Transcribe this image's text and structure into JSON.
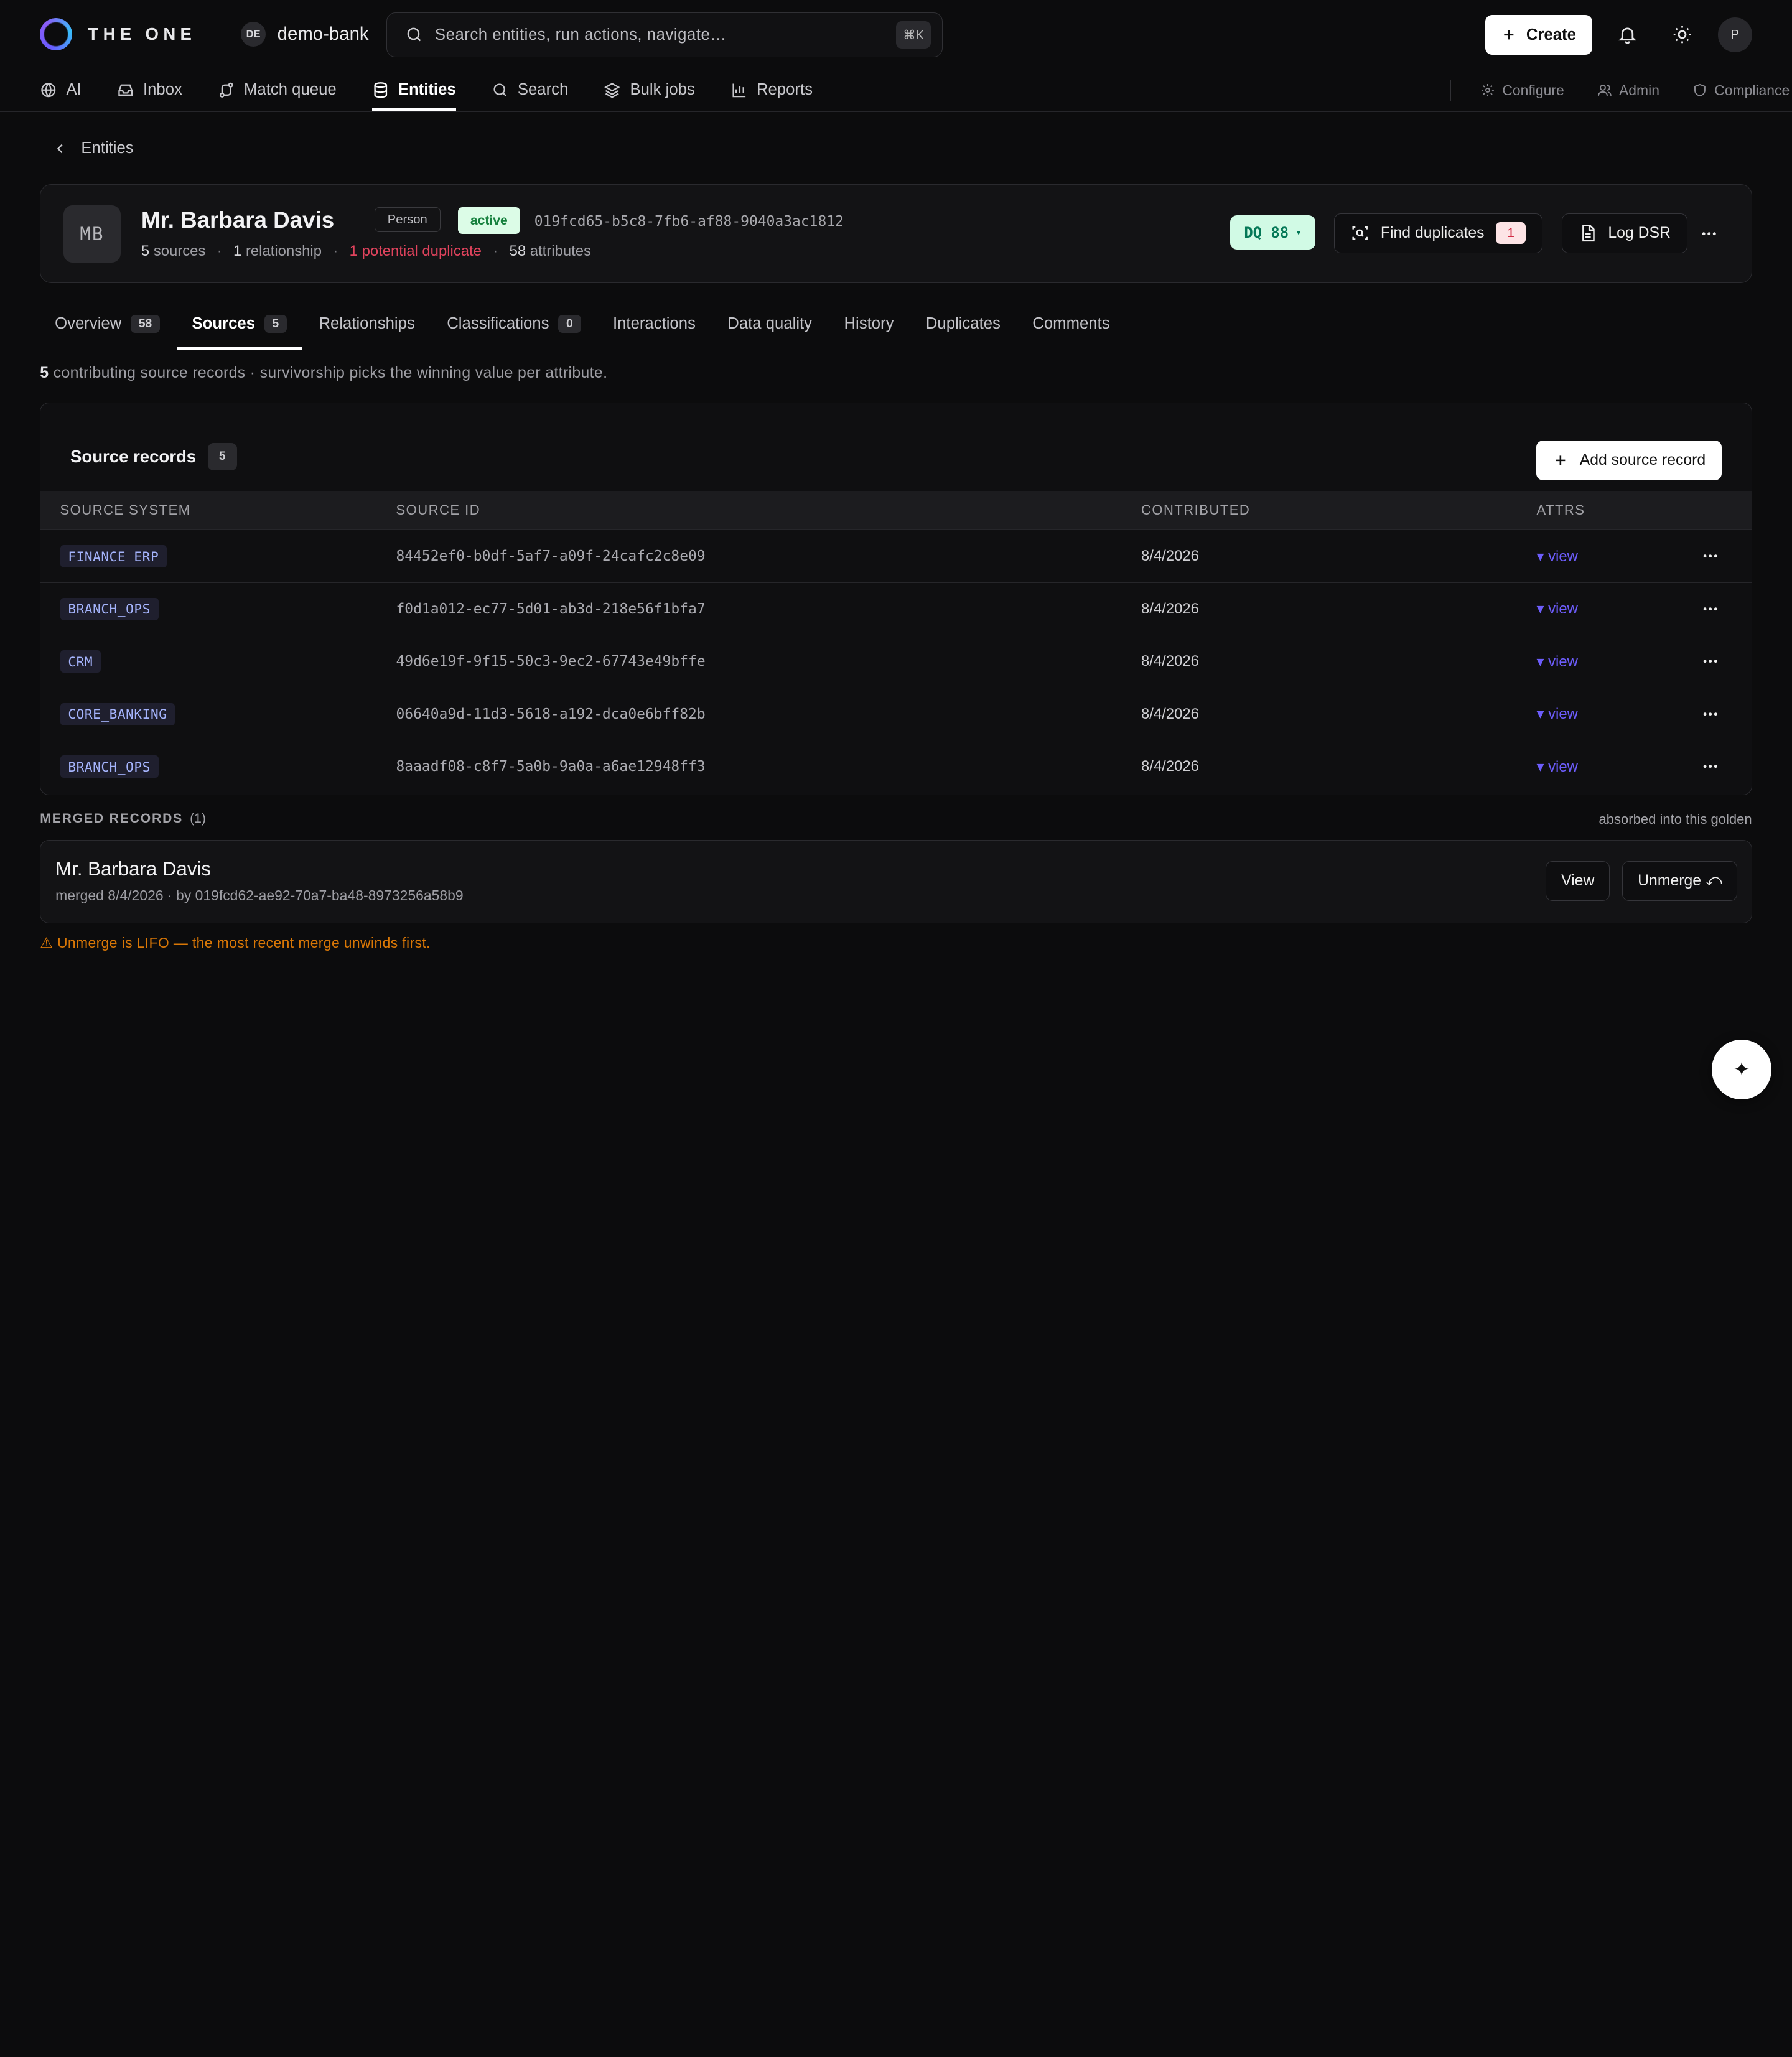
{
  "app": {
    "brand": "THE ONE",
    "workspace_initials": "DE",
    "workspace_name": "demo-bank"
  },
  "search": {
    "placeholder": "Search entities, run actions, navigate…",
    "shortcut": "⌘K"
  },
  "topbar": {
    "create_label": "Create",
    "avatar_initial": "P",
    "icons": [
      "plus-icon",
      "bell-icon",
      "sun-icon"
    ]
  },
  "nav": {
    "items": [
      {
        "label": "AI",
        "icon": "globe-icon"
      },
      {
        "label": "Inbox",
        "icon": "inbox-icon"
      },
      {
        "label": "Match queue",
        "icon": "route-icon"
      },
      {
        "label": "Entities",
        "icon": "database-icon",
        "active": true
      },
      {
        "label": "Search",
        "icon": "search-icon"
      },
      {
        "label": "Bulk jobs",
        "icon": "layers-icon"
      },
      {
        "label": "Reports",
        "icon": "bar-chart-icon"
      }
    ],
    "right": [
      {
        "label": "Configure",
        "icon": "gear-icon"
      },
      {
        "label": "Admin",
        "icon": "users-icon"
      },
      {
        "label": "Compliance",
        "icon": "shield-icon"
      }
    ]
  },
  "breadcrumb": {
    "back_label": "Entities"
  },
  "entity": {
    "initials": "MB",
    "name": "Mr. Barbara Davis",
    "type": "Person",
    "status": "active",
    "id": "019fcd65-b5c8-7fb6-af88-9040a3ac1812",
    "meta": {
      "sources_count": "5",
      "sources_label": "sources",
      "relationships_count": "1",
      "relationships_label": "relationship",
      "duplicate_text": "1 potential duplicate",
      "attributes_count": "58",
      "attributes_label": "attributes"
    },
    "dq_label": "DQ 88",
    "find_duplicates_label": "Find duplicates",
    "find_duplicates_count": "1",
    "log_dsr_label": "Log DSR"
  },
  "tabs": [
    {
      "label": "Overview",
      "count": "58"
    },
    {
      "label": "Sources",
      "count": "5",
      "active": true
    },
    {
      "label": "Relationships"
    },
    {
      "label": "Classifications",
      "count": "0"
    },
    {
      "label": "Interactions"
    },
    {
      "label": "Data quality"
    },
    {
      "label": "History"
    },
    {
      "label": "Duplicates"
    },
    {
      "label": "Comments"
    }
  ],
  "summary": {
    "count": "5",
    "text": "contributing source records · survivorship picks the winning value per attribute."
  },
  "source_records": {
    "title": "Source records",
    "count": "5",
    "add_label": "Add source record",
    "columns": [
      "SOURCE SYSTEM",
      "SOURCE ID",
      "CONTRIBUTED",
      "ATTRS"
    ],
    "rows": [
      {
        "system": "FINANCE_ERP",
        "id": "84452ef0-b0df-5af7-a09f-24cafc2c8e09",
        "contributed": "8/4/2026",
        "attrs": "▾ view"
      },
      {
        "system": "BRANCH_OPS",
        "id": "f0d1a012-ec77-5d01-ab3d-218e56f1bfa7",
        "contributed": "8/4/2026",
        "attrs": "▾ view"
      },
      {
        "system": "CRM",
        "id": "49d6e19f-9f15-50c3-9ec2-67743e49bffe",
        "contributed": "8/4/2026",
        "attrs": "▾ view"
      },
      {
        "system": "CORE_BANKING",
        "id": "06640a9d-11d3-5618-a192-dca0e6bff82b",
        "contributed": "8/4/2026",
        "attrs": "▾ view"
      },
      {
        "system": "BRANCH_OPS",
        "id": "8aaadf08-c8f7-5a0b-9a0a-a6ae12948ff3",
        "contributed": "8/4/2026",
        "attrs": "▾ view"
      }
    ]
  },
  "merged": {
    "title": "MERGED RECORDS",
    "count": "(1)",
    "note": "absorbed into this golden",
    "record_name": "Mr. Barbara Davis",
    "record_sub": "merged 8/4/2026 · by 019fcd62-ae92-70a7-ba48-8973256a58b9",
    "view_label": "View",
    "unmerge_label": "Unmerge ⤺",
    "warning": "⚠ Unmerge is LIFO — the most recent merge unwinds first."
  },
  "fab": {
    "glyph": "✦"
  },
  "colors": {
    "accent": "#6d5dfc",
    "success_bg": "#dcfce7",
    "success_fg": "#15803d",
    "danger": "#e0435d",
    "warning": "#d97706"
  }
}
